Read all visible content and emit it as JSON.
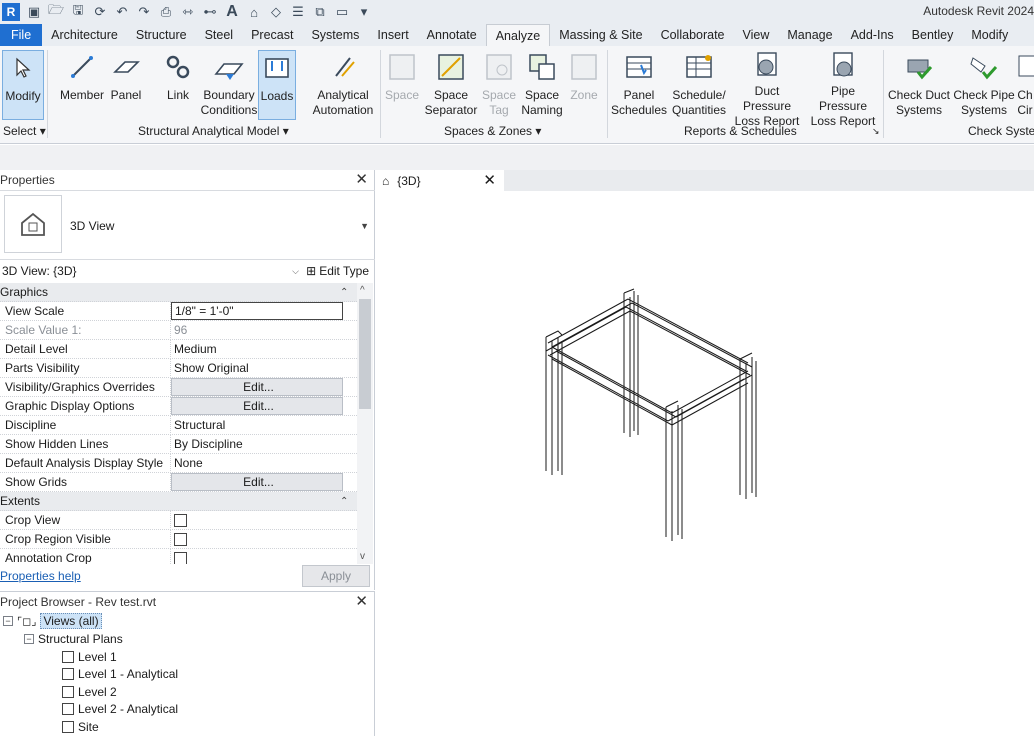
{
  "app": {
    "title": "Autodesk Revit 2024"
  },
  "tabs": [
    "File",
    "Architecture",
    "Structure",
    "Steel",
    "Precast",
    "Systems",
    "Insert",
    "Annotate",
    "Analyze",
    "Massing & Site",
    "Collaborate",
    "View",
    "Manage",
    "Add-Ins",
    "Bentley",
    "Modify"
  ],
  "active_tab": "Analyze",
  "ribbon": {
    "modify": "Modify",
    "member": "Member",
    "panel": "Panel",
    "link": "Link",
    "boundary1": "Boundary",
    "boundary2": "Conditions",
    "loads": "Loads",
    "analytical1": "Analytical",
    "analytical2": "Automation",
    "space": "Space",
    "space_sep1": "Space",
    "space_sep2": "Separator",
    "space_tag1": "Space",
    "space_tag2": "Tag",
    "space_naming1": "Space",
    "space_naming2": "Naming",
    "zone": "Zone",
    "panel_sched1": "Panel",
    "panel_sched2": "Schedules",
    "schedule1": "Schedule/",
    "schedule2": "Quantities",
    "duct_pressure1": "Duct Pressure",
    "duct_pressure2": "Loss Report",
    "pipe_pressure1": "Pipe Pressure",
    "pipe_pressure2": "Loss Report",
    "check_duct1": "Check Duct",
    "check_duct2": "Systems",
    "check_pipe1": "Check Pipe",
    "check_pipe2": "Systems",
    "check_circ1": "Ch",
    "check_circ2": "Cir",
    "labels": {
      "select": "Select",
      "structural_analytical": "Structural Analytical Model",
      "spaces_zones": "Spaces & Zones",
      "reports": "Reports & Schedules",
      "check_systems": "Check Syster"
    }
  },
  "properties": {
    "header": "Properties",
    "type_name": "3D View",
    "selector": "3D View: {3D}",
    "edit_type": "Edit Type",
    "rows": [
      {
        "group": "Graphics"
      },
      {
        "k": "View Scale",
        "v": "1/8\" = 1'-0\"",
        "style": "boxed"
      },
      {
        "k": "Scale Value    1:",
        "v": "96",
        "style": "dim"
      },
      {
        "k": "Detail Level",
        "v": "Medium"
      },
      {
        "k": "Parts Visibility",
        "v": "Show Original"
      },
      {
        "k": "Visibility/Graphics Overrides",
        "v": "Edit...",
        "style": "btn"
      },
      {
        "k": "Graphic Display Options",
        "v": "Edit...",
        "style": "btn"
      },
      {
        "k": "Discipline",
        "v": "Structural"
      },
      {
        "k": "Show Hidden Lines",
        "v": "By Discipline"
      },
      {
        "k": "Default Analysis Display Style",
        "v": "None"
      },
      {
        "k": "Show Grids",
        "v": "Edit...",
        "style": "btn"
      },
      {
        "group": "Extents"
      },
      {
        "k": "Crop View",
        "v": "",
        "style": "check"
      },
      {
        "k": "Crop Region Visible",
        "v": "",
        "style": "check"
      },
      {
        "k": "Annotation Crop",
        "v": "",
        "style": "check"
      }
    ],
    "help": "Properties help",
    "apply": "Apply"
  },
  "browser": {
    "header": "Project Browser - Rev test.rvt",
    "root": "Views (all)",
    "group": "Structural Plans",
    "items": [
      "Level 1",
      "Level 1 - Analytical",
      "Level 2",
      "Level 2 - Analytical",
      "Site"
    ]
  },
  "view_tab": {
    "label": "{3D}"
  }
}
